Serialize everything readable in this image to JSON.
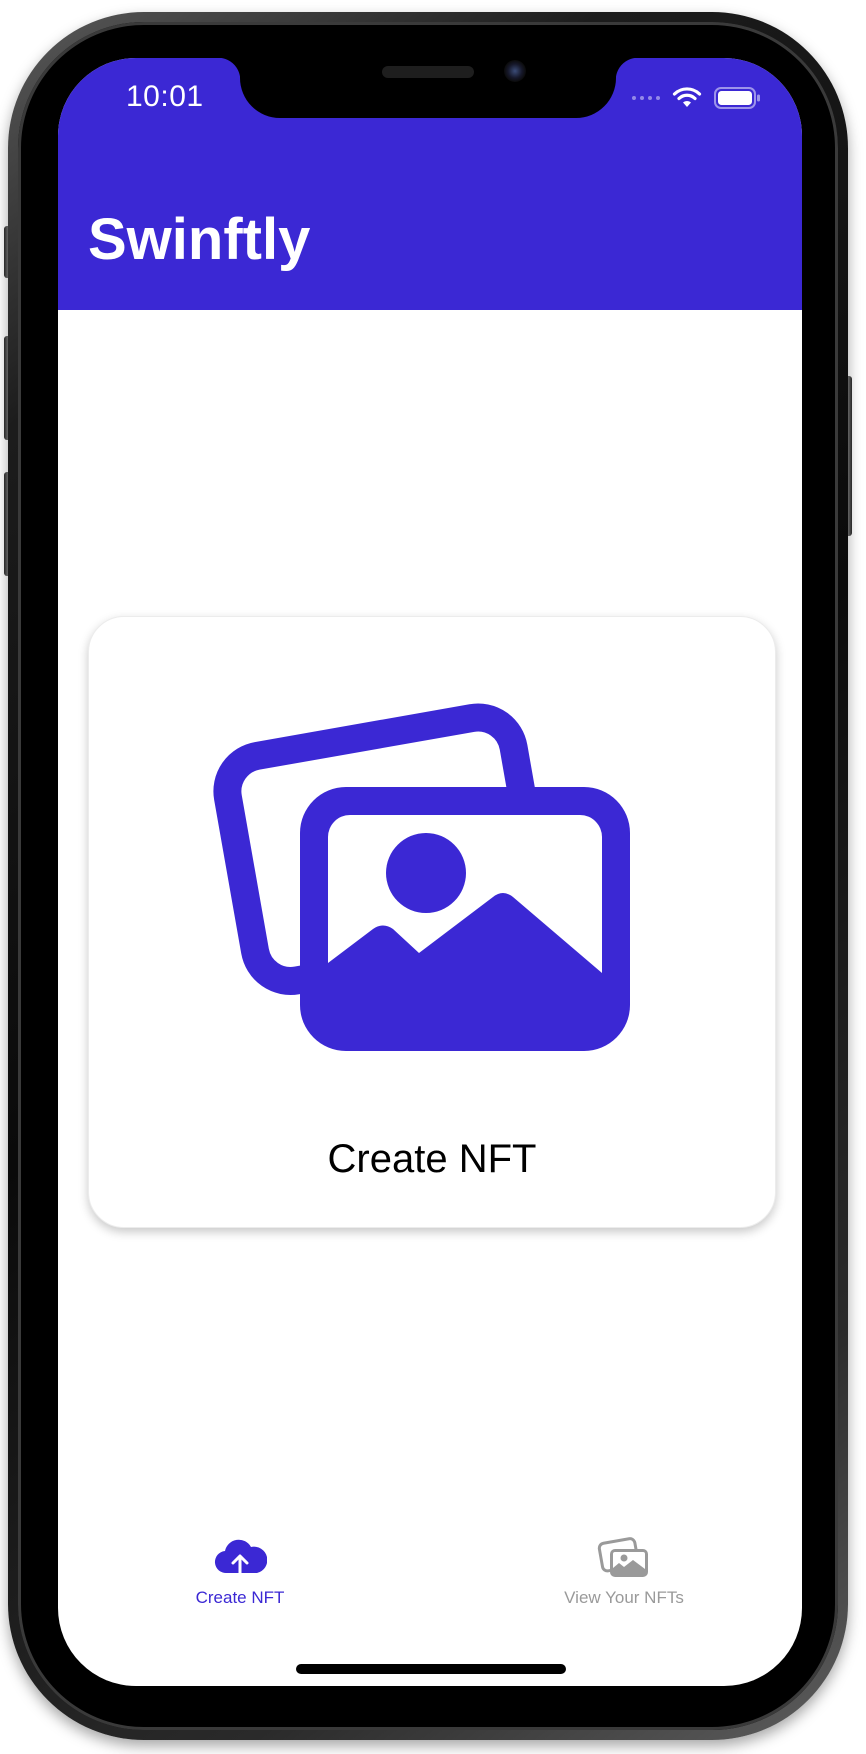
{
  "status_bar": {
    "time": "10:01"
  },
  "nav": {
    "title": "Swinftly"
  },
  "card": {
    "label": "Create NFT",
    "icon": "photo-stack-icon"
  },
  "tab_bar": {
    "tabs": [
      {
        "label": "Create NFT",
        "icon": "cloud-upload-icon",
        "selected": true
      },
      {
        "label": "View Your NFTs",
        "icon": "photo-stack-icon",
        "selected": false
      }
    ]
  },
  "colors": {
    "accent": "#3b28d4",
    "inactive": "#9a9a9a",
    "background": "#ffffff"
  }
}
